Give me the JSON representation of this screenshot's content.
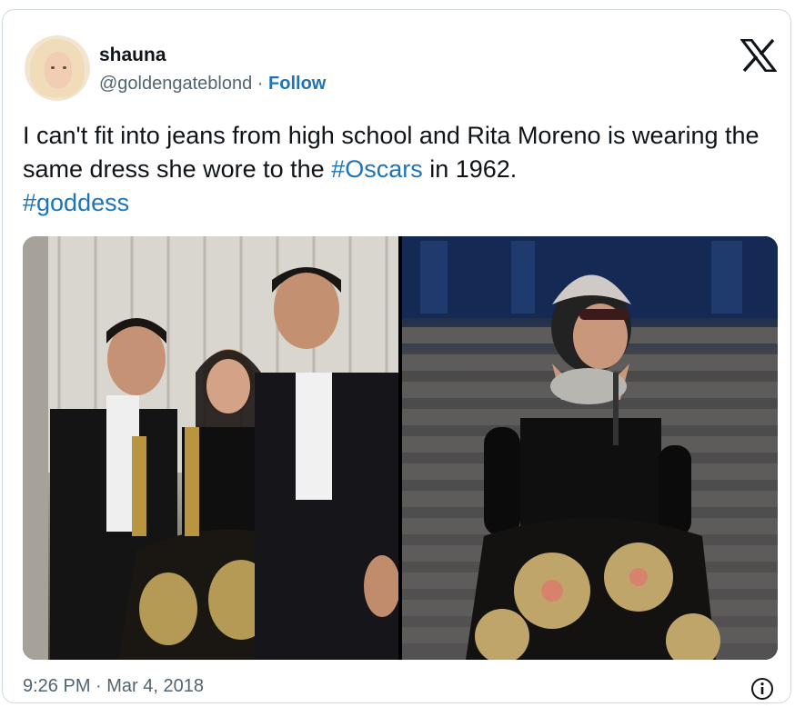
{
  "user": {
    "display_name": "shauna",
    "handle": "@goldengateblond",
    "separator": " · ",
    "follow_label": "Follow"
  },
  "tweet": {
    "text_part1": "I can't fit into jeans from high school and Rita Moreno is wearing the same dress she wore to the ",
    "hashtag1": "#Oscars",
    "text_part2": " in 1962.",
    "hashtag2": "#goddess"
  },
  "footer": {
    "timestamp": "9:26 PM · Mar 4, 2018"
  },
  "icons": {
    "logo": "x-logo-icon",
    "info": "info-icon"
  },
  "colors": {
    "link": "#1d74b9",
    "text": "#0f1419",
    "secondary": "#536471",
    "border": "#cfd9de"
  }
}
